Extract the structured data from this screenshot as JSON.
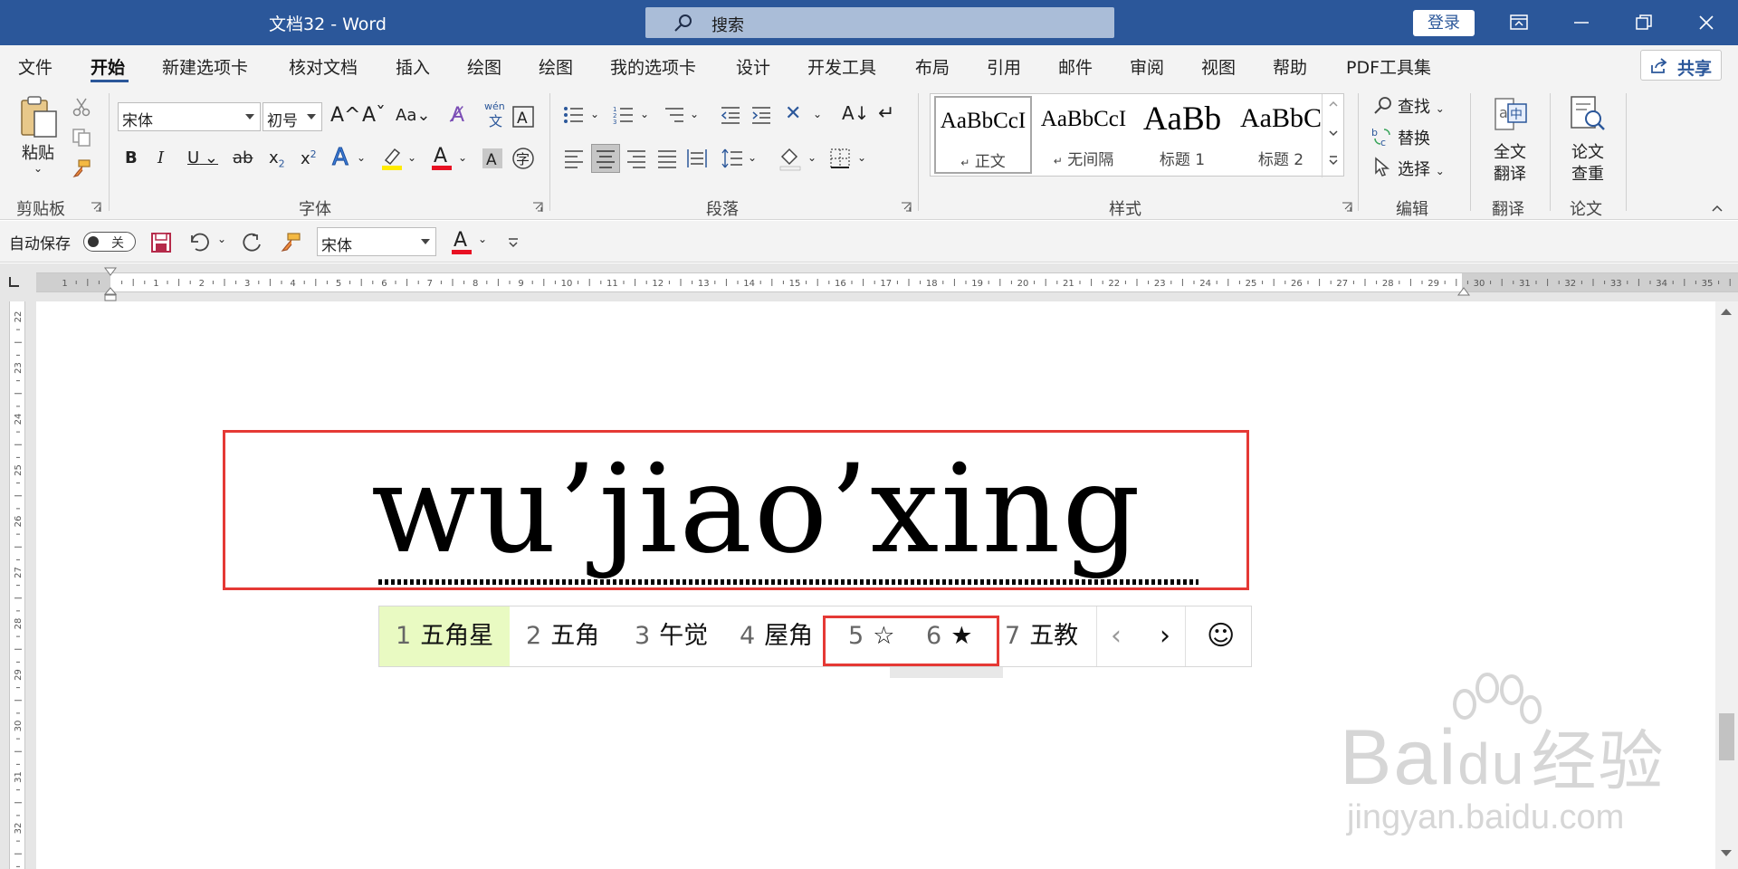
{
  "titlebar": {
    "title": "文档32  -  Word",
    "search_label": "搜索",
    "login_label": "登录"
  },
  "tabs": [
    "文件",
    "开始",
    "新建选项卡",
    "核对文档",
    "插入",
    "绘图",
    "绘图",
    "我的选项卡",
    "设计",
    "开发工具",
    "布局",
    "引用",
    "邮件",
    "审阅",
    "视图",
    "帮助",
    "PDF工具集"
  ],
  "active_tab": "开始",
  "share_label": "共享",
  "ribbon": {
    "clipboard": {
      "paste_label": "粘贴",
      "group_label": "剪贴板"
    },
    "font": {
      "font_name": "宋体",
      "font_size": "初号",
      "group_label": "字体",
      "bold": "B",
      "italic": "I",
      "underline": "U",
      "strike": "ab",
      "case": "Aa",
      "phonetic": "wén"
    },
    "paragraph": {
      "group_label": "段落"
    },
    "styles": {
      "group_label": "样式",
      "items": [
        {
          "sample": "AaBbCcI",
          "name": "正文",
          "marker": "↵"
        },
        {
          "sample": "AaBbCcI",
          "name": "无间隔",
          "marker": "↵"
        },
        {
          "sample": "AaBb",
          "name": "标题 1"
        },
        {
          "sample": "AaBbC",
          "name": "标题 2"
        }
      ]
    },
    "editing": {
      "group_label": "编辑",
      "find": "查找",
      "replace": "替换",
      "select": "选择"
    },
    "translate": {
      "group_label": "翻译",
      "full_translate_line1": "全文",
      "full_translate_line2": "翻译"
    },
    "paper": {
      "group_label": "论文",
      "check_line1": "论文",
      "check_line2": "查重"
    }
  },
  "qat": {
    "autosave_label": "自动保存",
    "toggle_state": "关",
    "font_name": "宋体"
  },
  "document": {
    "pinyin_text": "wu’jiao’xing"
  },
  "ime": {
    "candidates": [
      {
        "num": "1",
        "text": "五角星"
      },
      {
        "num": "2",
        "text": "五角"
      },
      {
        "num": "3",
        "text": "午觉"
      },
      {
        "num": "4",
        "text": "屋角"
      },
      {
        "num": "5",
        "text": "☆"
      },
      {
        "num": "6",
        "text": "★"
      },
      {
        "num": "7",
        "text": "五教"
      }
    ],
    "prev": "‹",
    "next": "›",
    "emoji": "☺"
  },
  "ruler": {
    "h_numbers": [
      "1",
      "1",
      "2",
      "3",
      "4",
      "5",
      "6",
      "7",
      "8",
      "9",
      "10",
      "11",
      "12",
      "13",
      "14",
      "15",
      "16",
      "17",
      "18",
      "19",
      "20",
      "21",
      "22",
      "23",
      "24",
      "25",
      "26",
      "27",
      "28",
      "29",
      "30",
      "31",
      "32",
      "33",
      "34",
      "35"
    ],
    "v_numbers": [
      "22",
      "23",
      "24",
      "25",
      "26",
      "27",
      "28",
      "29",
      "30",
      "31",
      "32"
    ]
  },
  "watermark": {
    "brand": "Bai",
    "brand2": "du",
    "brand_cn": "经验",
    "url": "jingyan.baidu.com"
  },
  "colors": {
    "title_bar": "#2b579a",
    "highlight_red": "#e53935",
    "first_candidate_bg": "#e9fac2"
  }
}
